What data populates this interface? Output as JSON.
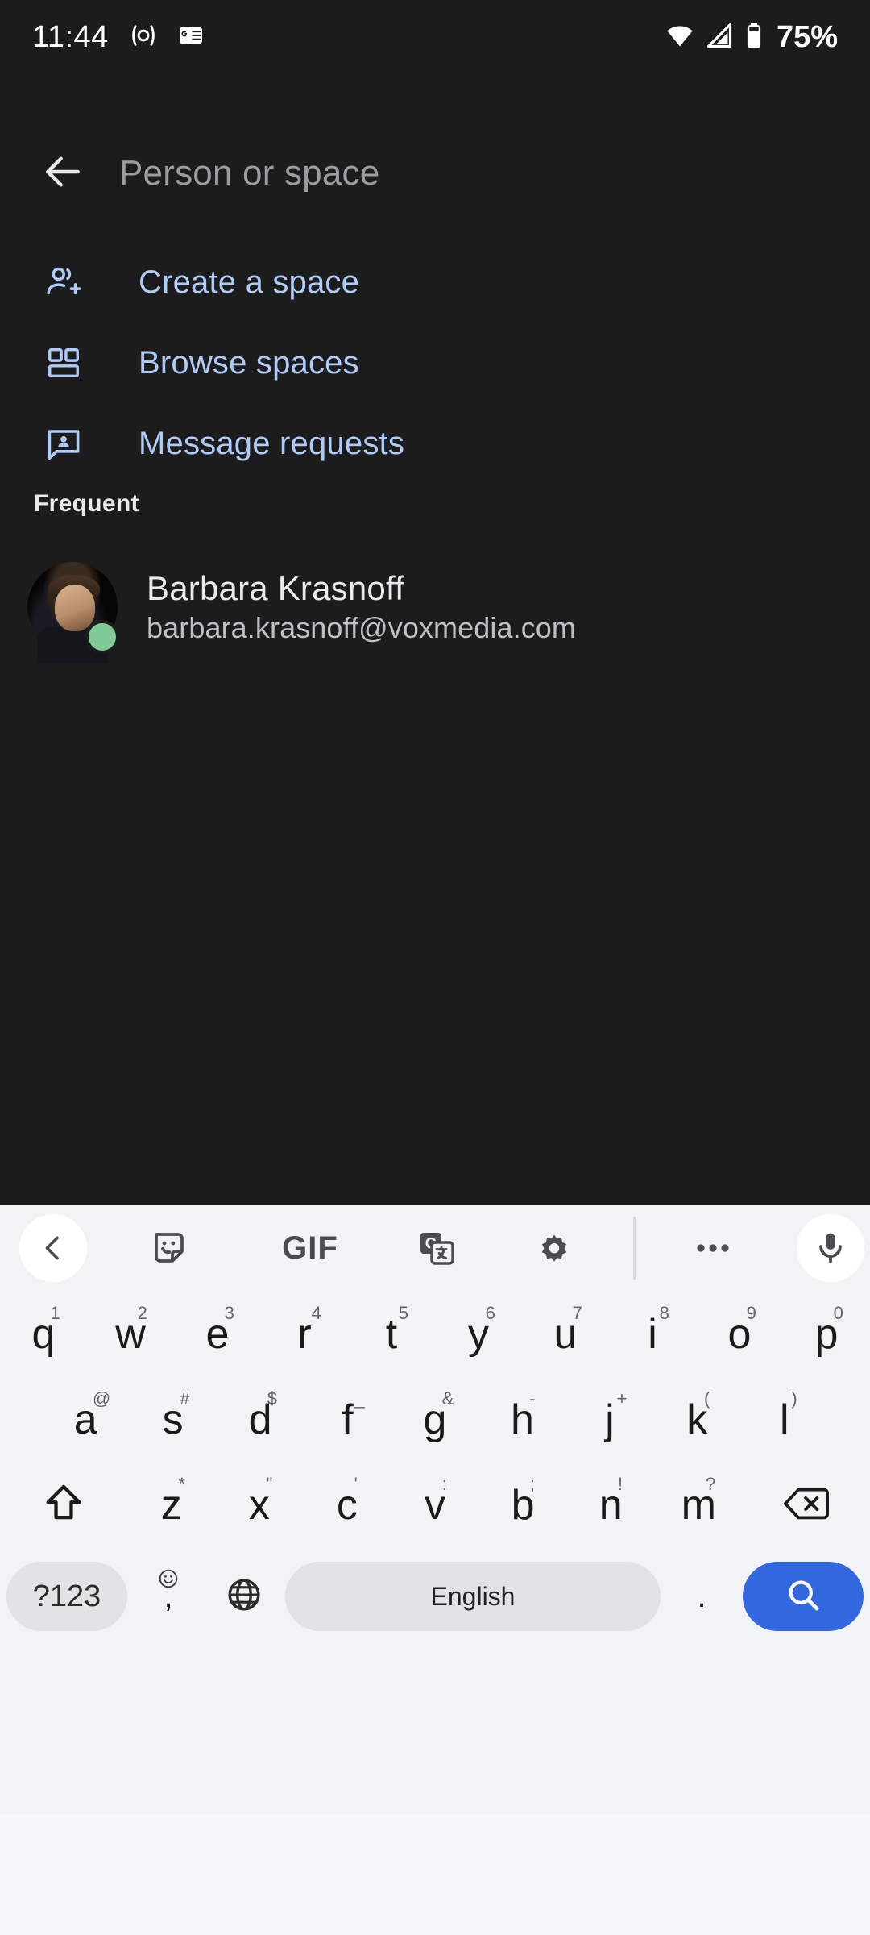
{
  "statusbar": {
    "time": "11:44",
    "battery_percent": "75%",
    "icons": [
      "cast-icon",
      "google-news-icon",
      "wifi-icon",
      "cellular-signal-icon",
      "battery-icon"
    ]
  },
  "header": {
    "back_icon": "back-arrow-icon",
    "search_placeholder": "Person or space",
    "search_value": ""
  },
  "menu": {
    "items": [
      {
        "icon": "person-add-icon",
        "label": "Create a space"
      },
      {
        "icon": "grid-spaces-icon",
        "label": "Browse spaces"
      },
      {
        "icon": "message-request-icon",
        "label": "Message requests"
      }
    ]
  },
  "frequent": {
    "title": "Frequent",
    "contacts": [
      {
        "name": "Barbara Krasnoff",
        "email": "barbara.krasnoff@voxmedia.com",
        "presence": "available"
      }
    ]
  },
  "keyboard": {
    "toolbar": [
      "collapse-toolbar-icon",
      "sticker-icon",
      "gif-icon",
      "translate-icon",
      "settings-gear-icon",
      "overflow-menu-icon",
      "microphone-icon"
    ],
    "gif_label": "GIF",
    "rows": [
      [
        {
          "key": "q",
          "hint": "1"
        },
        {
          "key": "w",
          "hint": "2"
        },
        {
          "key": "e",
          "hint": "3"
        },
        {
          "key": "r",
          "hint": "4"
        },
        {
          "key": "t",
          "hint": "5"
        },
        {
          "key": "y",
          "hint": "6"
        },
        {
          "key": "u",
          "hint": "7"
        },
        {
          "key": "i",
          "hint": "8"
        },
        {
          "key": "o",
          "hint": "9"
        },
        {
          "key": "p",
          "hint": "0"
        }
      ],
      [
        {
          "key": "a",
          "hint": "@"
        },
        {
          "key": "s",
          "hint": "#"
        },
        {
          "key": "d",
          "hint": "$"
        },
        {
          "key": "f",
          "hint": "_"
        },
        {
          "key": "g",
          "hint": "&"
        },
        {
          "key": "h",
          "hint": "-"
        },
        {
          "key": "j",
          "hint": "+"
        },
        {
          "key": "k",
          "hint": "("
        },
        {
          "key": "l",
          "hint": ")"
        }
      ],
      [
        {
          "key": "z",
          "hint": "*"
        },
        {
          "key": "x",
          "hint": "\""
        },
        {
          "key": "c",
          "hint": "'"
        },
        {
          "key": "v",
          "hint": ":"
        },
        {
          "key": "b",
          "hint": ";"
        },
        {
          "key": "n",
          "hint": "!"
        },
        {
          "key": "m",
          "hint": "?"
        }
      ]
    ],
    "shift_icon": "shift-icon",
    "backspace_icon": "backspace-icon",
    "symbols_label": "?123",
    "comma_key": ",",
    "comma_hint": "emoji-icon",
    "globe_icon": "language-globe-icon",
    "space_label": "English",
    "period_key": ".",
    "enter_icon": "search-icon"
  },
  "colors": {
    "app_background": "#1c1c1c",
    "accent_blue": "#aecbfa",
    "keyboard_background": "#f2f3f4",
    "key_gray": "#e1e3e4",
    "enter_blue": "#3367e0",
    "presence_green": "#81c995",
    "nav_background": "#f7f8f9"
  }
}
